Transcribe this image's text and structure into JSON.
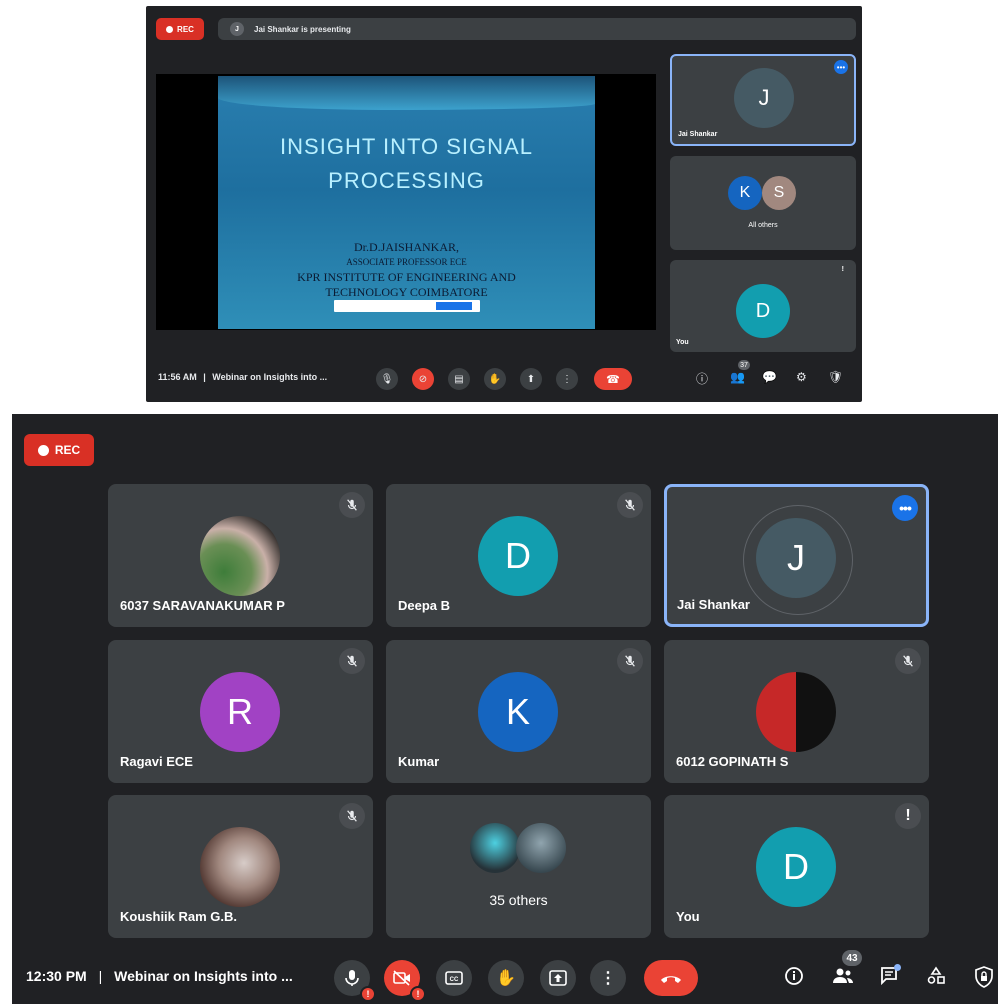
{
  "top_meeting": {
    "rec_label": "REC",
    "presenting_text": "Jai Shankar is presenting",
    "presenter_initial": "J",
    "slide": {
      "title_line1": "INSIGHT INTO SIGNAL",
      "title_line2": "PROCESSING",
      "author": "Dr.D.JAISHANKAR,",
      "role": "ASSOCIATE PROFESSOR ECE",
      "institute_line1": "KPR INSTITUTE OF ENGINEERING AND",
      "institute_line2": "TECHNOLOGY COIMBATORE"
    },
    "tiles": [
      {
        "initial": "J",
        "name": "Jai Shankar"
      },
      {
        "initials": [
          "K",
          "S"
        ],
        "name": "All others"
      },
      {
        "initial": "D",
        "name": "You"
      }
    ],
    "time": "11:56 AM",
    "meeting_title": "Webinar on Insights into ...",
    "participants_count": "37"
  },
  "bottom_meeting": {
    "rec_label": "REC",
    "tiles": [
      {
        "name": "6037 SARAVANAKUMAR P",
        "type": "photo",
        "muted": true
      },
      {
        "name": "Deepa B",
        "initial": "D",
        "color": "#129eaf",
        "muted": true
      },
      {
        "name": "Jai Shankar",
        "initial": "J",
        "color": "#455a64",
        "selected": true
      },
      {
        "name": "Ragavi ECE",
        "initial": "R",
        "color": "#a142c4",
        "muted": true
      },
      {
        "name": "Kumar",
        "initial": "K",
        "color": "#1565c0",
        "muted": true
      },
      {
        "name": "6012 GOPINATH S",
        "type": "photo",
        "muted": true
      },
      {
        "name": "Koushiik Ram G.B.",
        "type": "photo",
        "muted": true
      },
      {
        "others_label": "35 others"
      },
      {
        "name": "You",
        "initial": "D",
        "color": "#129eaf",
        "warning": "!"
      }
    ],
    "time": "12:30 PM",
    "meeting_title": "Webinar on Insights into ...",
    "participants_count": "43",
    "alert_mark": "!",
    "more_dots": "•••"
  }
}
